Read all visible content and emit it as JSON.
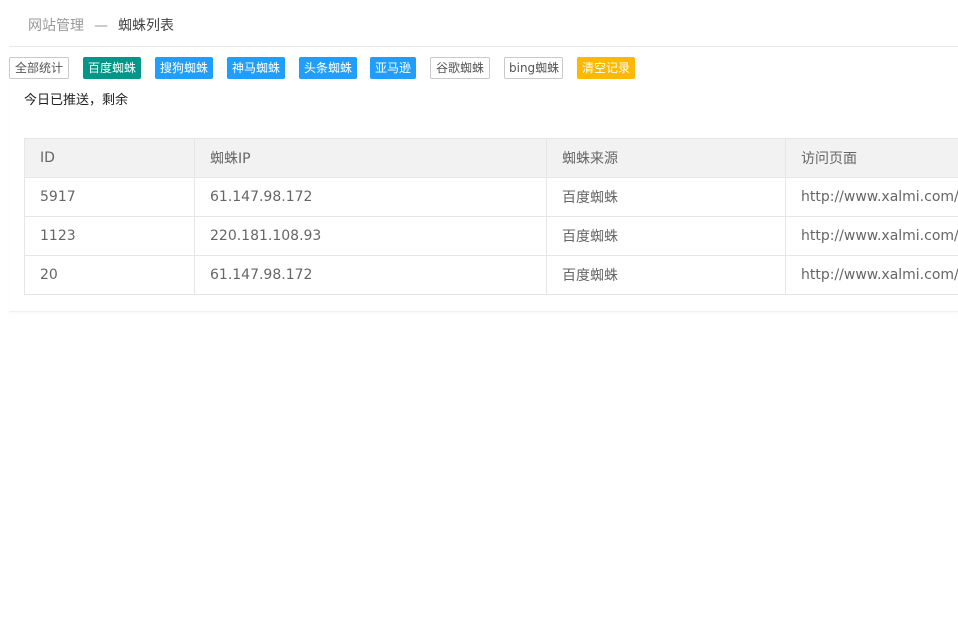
{
  "breadcrumb": {
    "parent": "网站管理",
    "separator": "—",
    "current": "蜘蛛列表"
  },
  "toolbar": {
    "buttons": [
      {
        "label": "全部统计",
        "style": "default"
      },
      {
        "label": "百度蜘蛛",
        "style": "green",
        "color": "#009688"
      },
      {
        "label": "搜狗蜘蛛",
        "style": "blue",
        "color": "#1e9fff"
      },
      {
        "label": "神马蜘蛛",
        "style": "blue",
        "color": "#1e9fff"
      },
      {
        "label": "头条蜘蛛",
        "style": "blue",
        "color": "#1e9fff"
      },
      {
        "label": "亚马逊",
        "style": "blue",
        "color": "#1e9fff"
      },
      {
        "label": "谷歌蜘蛛",
        "style": "default"
      },
      {
        "label": "bing蜘蛛",
        "style": "default"
      },
      {
        "label": "清空记录",
        "style": "orange",
        "color": "#ffb800"
      }
    ]
  },
  "push_info": "今日已推送，剩余",
  "table": {
    "columns": [
      "ID",
      "蜘蛛IP",
      "蜘蛛来源",
      "访问页面"
    ],
    "rows": [
      [
        "5917",
        "61.147.98.172",
        "百度蜘蛛",
        "http://www.xalmi.com/"
      ],
      [
        "1123",
        "220.181.108.93",
        "百度蜘蛛",
        "http://www.xalmi.com/"
      ],
      [
        "20",
        "61.147.98.172",
        "百度蜘蛛",
        "http://www.xalmi.com/"
      ]
    ]
  }
}
